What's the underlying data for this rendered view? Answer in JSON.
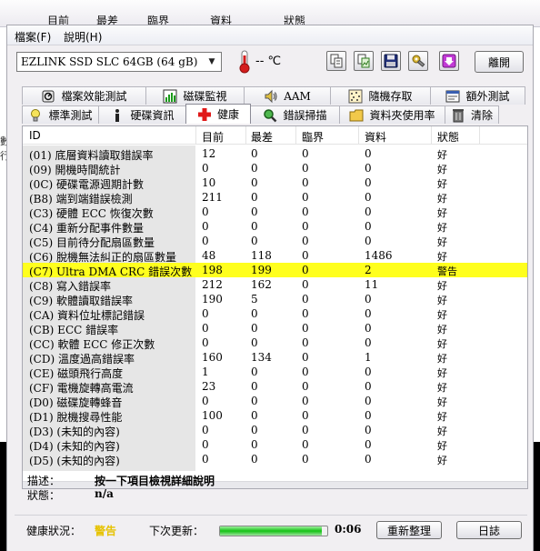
{
  "background_window": {
    "columns": [
      "目前",
      "最差",
      "臨界",
      "資料",
      "狀態"
    ],
    "left_fragments": [
      "數",
      "行"
    ]
  },
  "menu": {
    "file": "檔案(F)",
    "help": "說明(H)"
  },
  "toolbar": {
    "drive": "EZLINK  SSD SLC 64GB     (64 gB)",
    "temperature": "-- ℃",
    "exit_label": "離開"
  },
  "tabs_top": [
    {
      "label": "檔案效能測試",
      "icon": "file-benchmark-icon"
    },
    {
      "label": "磁碟監視",
      "icon": "disk-monitor-icon"
    },
    {
      "label": "AAM",
      "icon": "speaker-icon"
    },
    {
      "label": "隨機存取",
      "icon": "random-access-icon"
    },
    {
      "label": "額外測試",
      "icon": "extra-tests-icon"
    }
  ],
  "tabs_bottom": [
    {
      "label": "標準測試",
      "icon": "benchmark-icon"
    },
    {
      "label": "硬碟資訊",
      "icon": "info-icon"
    },
    {
      "label": "健康",
      "icon": "health-cross-icon",
      "active": true
    },
    {
      "label": "錯誤掃描",
      "icon": "error-scan-icon"
    },
    {
      "label": "資料夾使用率",
      "icon": "folder-usage-icon"
    },
    {
      "label": "清除",
      "icon": "erase-bin-icon"
    }
  ],
  "table": {
    "headers": [
      "ID",
      "目前",
      "最差",
      "臨界",
      "資料",
      "狀態"
    ],
    "rows": [
      {
        "id": "(01) 底層資料讀取錯誤率",
        "cur": "12",
        "worst": "0",
        "thr": "0",
        "data": "0",
        "status": "好"
      },
      {
        "id": "(09) 開機時間統計",
        "cur": "0",
        "worst": "0",
        "thr": "0",
        "data": "0",
        "status": "好"
      },
      {
        "id": "(0C) 硬碟電源週期計數",
        "cur": "10",
        "worst": "0",
        "thr": "0",
        "data": "0",
        "status": "好"
      },
      {
        "id": "(B8) 端到端錯誤檢測",
        "cur": "211",
        "worst": "0",
        "thr": "0",
        "data": "0",
        "status": "好"
      },
      {
        "id": "(C3) 硬體 ECC 恢復次數",
        "cur": "0",
        "worst": "0",
        "thr": "0",
        "data": "0",
        "status": "好"
      },
      {
        "id": "(C4) 重新分配事件數量",
        "cur": "0",
        "worst": "0",
        "thr": "0",
        "data": "0",
        "status": "好"
      },
      {
        "id": "(C5) 目前待分配扇區數量",
        "cur": "0",
        "worst": "0",
        "thr": "0",
        "data": "0",
        "status": "好"
      },
      {
        "id": "(C6) 脫機無法糾正的扇區數量",
        "cur": "48",
        "worst": "118",
        "thr": "0",
        "data": "1486",
        "status": "好"
      },
      {
        "id": "(C7) Ultra DMA CRC 錯誤次數",
        "cur": "198",
        "worst": "199",
        "thr": "0",
        "data": "2",
        "status": "警告",
        "warn": true
      },
      {
        "id": "(C8) 寫入錯誤率",
        "cur": "212",
        "worst": "162",
        "thr": "0",
        "data": "11",
        "status": "好"
      },
      {
        "id": "(C9) 軟體讀取錯誤率",
        "cur": "190",
        "worst": "5",
        "thr": "0",
        "data": "0",
        "status": "好"
      },
      {
        "id": "(CA) 資料位址標記錯誤",
        "cur": "0",
        "worst": "0",
        "thr": "0",
        "data": "0",
        "status": "好"
      },
      {
        "id": "(CB) ECC 錯誤率",
        "cur": "0",
        "worst": "0",
        "thr": "0",
        "data": "0",
        "status": "好"
      },
      {
        "id": "(CC) 軟體 ECC 修正次數",
        "cur": "0",
        "worst": "0",
        "thr": "0",
        "data": "0",
        "status": "好"
      },
      {
        "id": "(CD) 溫度過高錯誤率",
        "cur": "160",
        "worst": "134",
        "thr": "0",
        "data": "1",
        "status": "好"
      },
      {
        "id": "(CE) 磁頭飛行高度",
        "cur": "1",
        "worst": "0",
        "thr": "0",
        "data": "0",
        "status": "好"
      },
      {
        "id": "(CF) 電機旋轉高電流",
        "cur": "23",
        "worst": "0",
        "thr": "0",
        "data": "0",
        "status": "好"
      },
      {
        "id": "(D0) 磁碟旋轉蜂音",
        "cur": "0",
        "worst": "0",
        "thr": "0",
        "data": "0",
        "status": "好"
      },
      {
        "id": "(D1) 脫機搜尋性能",
        "cur": "100",
        "worst": "0",
        "thr": "0",
        "data": "0",
        "status": "好"
      },
      {
        "id": "(D3) (未知的內容)",
        "cur": "0",
        "worst": "0",
        "thr": "0",
        "data": "0",
        "status": "好"
      },
      {
        "id": "(D4) (未知的內容)",
        "cur": "0",
        "worst": "0",
        "thr": "0",
        "data": "0",
        "status": "好"
      },
      {
        "id": "(D5) (未知的內容)",
        "cur": "0",
        "worst": "0",
        "thr": "0",
        "data": "0",
        "status": "好"
      }
    ]
  },
  "info": {
    "desc_label": "描述：",
    "desc_value": "按一下項目檢視詳細說明",
    "status_label": "狀態：",
    "status_value": "n/a"
  },
  "bottom": {
    "health_label": "健康狀況：",
    "health_value": "警告",
    "next_update_label": "下次更新：",
    "next_update_value": "0:06",
    "progress_fraction": 0.95,
    "refresh_button": "重新整理",
    "log_button": "日誌"
  },
  "colors": {
    "warn_row": "#ffff1e",
    "warn_text": "#e6c200"
  }
}
